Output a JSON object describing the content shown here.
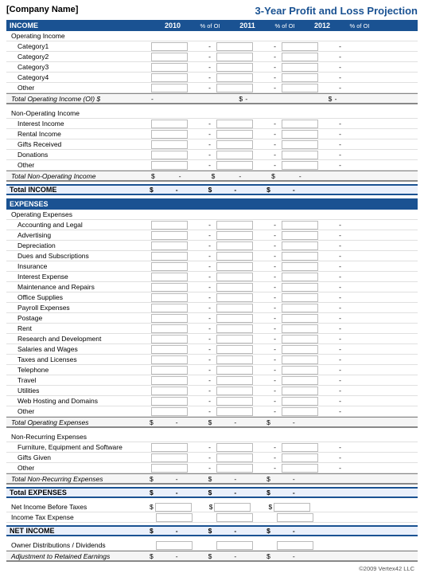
{
  "header": {
    "company": "[Company Name]",
    "title": "3-Year Profit and Loss Projection"
  },
  "columns": {
    "year1": "2010",
    "pct1": "% of OI",
    "year2": "2011",
    "pct2": "% of OI",
    "year3": "2012",
    "pct3": "% of OI"
  },
  "income": {
    "label": "INCOME",
    "operating": {
      "label": "Operating Income",
      "items": [
        "Category1",
        "Category2",
        "Category3",
        "Category4",
        "Other"
      ],
      "total_label": "Total Operating Income (OI)",
      "total_symbol": "$"
    },
    "non_operating": {
      "label": "Non-Operating Income",
      "items": [
        "Interest Income",
        "Rental Income",
        "Gifts Received",
        "Donations",
        "Other"
      ],
      "total_label": "Total Non-Operating Income"
    },
    "total_label": "Total INCOME"
  },
  "expenses": {
    "label": "EXPENSES",
    "operating": {
      "label": "Operating Expenses",
      "items": [
        "Accounting and Legal",
        "Advertising",
        "Depreciation",
        "Dues and Subscriptions",
        "Insurance",
        "Interest Expense",
        "Maintenance and Repairs",
        "Office Supplies",
        "Payroll Expenses",
        "Postage",
        "Rent",
        "Research and Development",
        "Salaries and Wages",
        "Taxes and Licenses",
        "Telephone",
        "Travel",
        "Utilities",
        "Web Hosting and Domains",
        "Other"
      ],
      "total_label": "Total Operating Expenses"
    },
    "non_recurring": {
      "label": "Non-Recurring Expenses",
      "items": [
        "Furniture, Equipment and Software",
        "Gifts Given",
        "Other"
      ],
      "total_label": "Total Non-Recurring Expenses"
    },
    "total_label": "Total EXPENSES"
  },
  "net": {
    "before_taxes": "Net Income Before Taxes",
    "tax_expense": "Income Tax Expense",
    "net_income": "NET INCOME",
    "distributions": "Owner Distributions / Dividends",
    "retained": "Adjustment to Retained Earnings"
  },
  "footer": "©2009 Vertex42 LLC"
}
